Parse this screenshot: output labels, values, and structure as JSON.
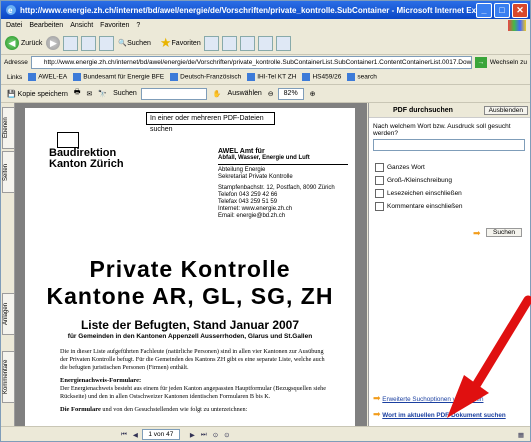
{
  "window": {
    "title": "http://www.energie.zh.ch/internet/bd/awel/energie/de/Vorschriften/private_kontrolle.SubContainer - Microsoft Internet Explorer",
    "minimize": "_",
    "maximize": "□",
    "close": "✕"
  },
  "menu": [
    "Datei",
    "Bearbeiten",
    "Ansicht",
    "Favoriten",
    "?"
  ],
  "toolbar": {
    "back_label": "Zurück",
    "search_label": "Suchen",
    "favorites_label": "Favoriten"
  },
  "address": {
    "label": "Adresse",
    "url": "http://www.energie.zh.ch/internet/bd/awel/energie/de/Vorschriften/private_kontrolle.SubContainerList.SubContainer1.ContentContainerList.0017.DownloadFile.pdf",
    "go_label": "Wechseln zu"
  },
  "links": {
    "label": "Links",
    "items": [
      "AWEL-EA",
      "Bundesamt für Energie BFE",
      "Deutsch-Französisch",
      "IHI-Tel KT ZH",
      "HS459/26",
      "search"
    ]
  },
  "pdf_toolbar": {
    "save_label": "Kopie speichern",
    "find_label": "Suchen",
    "zoom": "82%",
    "select_label": "Auswählen"
  },
  "left_tabs": [
    "Ebenen",
    "Seiten",
    "Anlagen",
    "Kommentare"
  ],
  "document": {
    "note_label": "In einer oder mehreren PDF-Dateien suchen",
    "org_line1": "Baudirektion",
    "org_line2": "Kanton Zürich",
    "awel_title": "AWEL  Amt für",
    "awel_sub": "Abfall, Wasser, Energie und Luft",
    "dept": "Abteilung Energie",
    "sekretariat": "Sekretariat Private Kontrolle",
    "address1": "Stampfenbachstr. 12, Postfach, 8090 Zürich",
    "phone": "Telefon 043 259 42 66",
    "fax": "Telefax 043 259 51 59",
    "web": "Internet: www.energie.zh.ch",
    "email": "Email: energie@bd.zh.ch",
    "title_line1": "Private Kontrolle",
    "title_line2": "Kantone AR, GL, SG, ZH",
    "list_title": "Liste der Befugten, Stand Januar 2007",
    "list_subtitle": "für Gemeinden in den Kantonen Appenzell Ausserrhoden, Glarus und St.Gallen",
    "para1": "Die in dieser Liste aufgeführten Fachleute (natürliche Personen) sind in allen vier Kantonen zur Ausübung der Privaten Kontrolle befugt. Für die Gemeinden des Kantons ZH gibt es eine separate Liste, welche auch die befugten juristischen Personen (Firmen) enthält.",
    "para2_head": "Energienachweis-Formulare:",
    "para2": "Der Energienachweis besteht aus einem für jeden Kanton angepassten Hauptformular (Bezugsquellen siehe Rückseite) und den in allen Ostschweizer Kantonen identischen Formularen B bis K.",
    "para3_head": "Die Formulare",
    "para3": "und von den Gesuchstellenden wie folgt zu unterzeichnen:"
  },
  "search_panel": {
    "title": "PDF durchsuchen",
    "hide_label": "Ausblenden",
    "question": "Nach welchem Wort bzw. Ausdruck soll gesucht werden?",
    "options": [
      "Ganzes Wort",
      "Groß-/Kleinschreibung",
      "Lesezeichen einschließen",
      "Kommentare einschließen"
    ],
    "search_button": "Suchen",
    "link1": "Erweiterte Suchoptionen verwenden",
    "link2": "Wort im aktuellen PDF-Dokument suchen"
  },
  "status": {
    "page": "1 von 47"
  }
}
